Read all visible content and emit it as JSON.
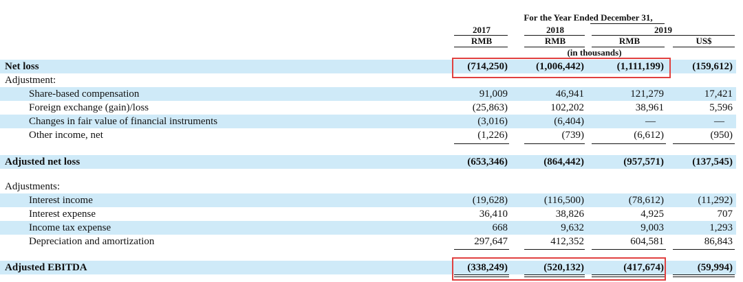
{
  "header": {
    "period": "For the Year Ended December 31,",
    "years": [
      "2017",
      "2018",
      "2019"
    ],
    "currencies": [
      "RMB",
      "RMB",
      "RMB",
      "US$"
    ],
    "units": "(in thousands)"
  },
  "rows": [
    {
      "label": "Net loss",
      "values": [
        "(714,250)",
        "(1,006,442)",
        "(1,111,199)",
        "(159,612)"
      ]
    },
    {
      "label": "Adjustment:"
    },
    {
      "label": "Share-based compensation",
      "values": [
        "91,009",
        "46,941",
        "121,279",
        "17,421"
      ]
    },
    {
      "label": "Foreign exchange (gain)/loss",
      "values": [
        "(25,863)",
        "102,202",
        "38,961",
        "5,596"
      ]
    },
    {
      "label": "Changes in fair value of financial instruments",
      "values": [
        "(3,016)",
        "(6,404)",
        "—",
        "—"
      ]
    },
    {
      "label": "Other income, net",
      "values": [
        "(1,226)",
        "(739)",
        "(6,612)",
        "(950)"
      ]
    },
    {
      "label": "Adjusted net loss",
      "values": [
        "(653,346)",
        "(864,442)",
        "(957,571)",
        "(137,545)"
      ]
    },
    {
      "label": "Adjustments:"
    },
    {
      "label": "Interest income",
      "values": [
        "(19,628)",
        "(116,500)",
        "(78,612)",
        "(11,292)"
      ]
    },
    {
      "label": "Interest expense",
      "values": [
        "36,410",
        "38,826",
        "4,925",
        "707"
      ]
    },
    {
      "label": "Income tax expense",
      "values": [
        "668",
        "9,632",
        "9,003",
        "1,293"
      ]
    },
    {
      "label": "Depreciation and amortization",
      "values": [
        "297,647",
        "412,352",
        "604,581",
        "86,843"
      ]
    },
    {
      "label": "Adjusted EBITDA",
      "values": [
        "(338,249)",
        "(520,132)",
        "(417,674)",
        "(59,994)"
      ]
    }
  ],
  "highlight_color": "#e0403f",
  "shade_color": "#cfeaf8"
}
